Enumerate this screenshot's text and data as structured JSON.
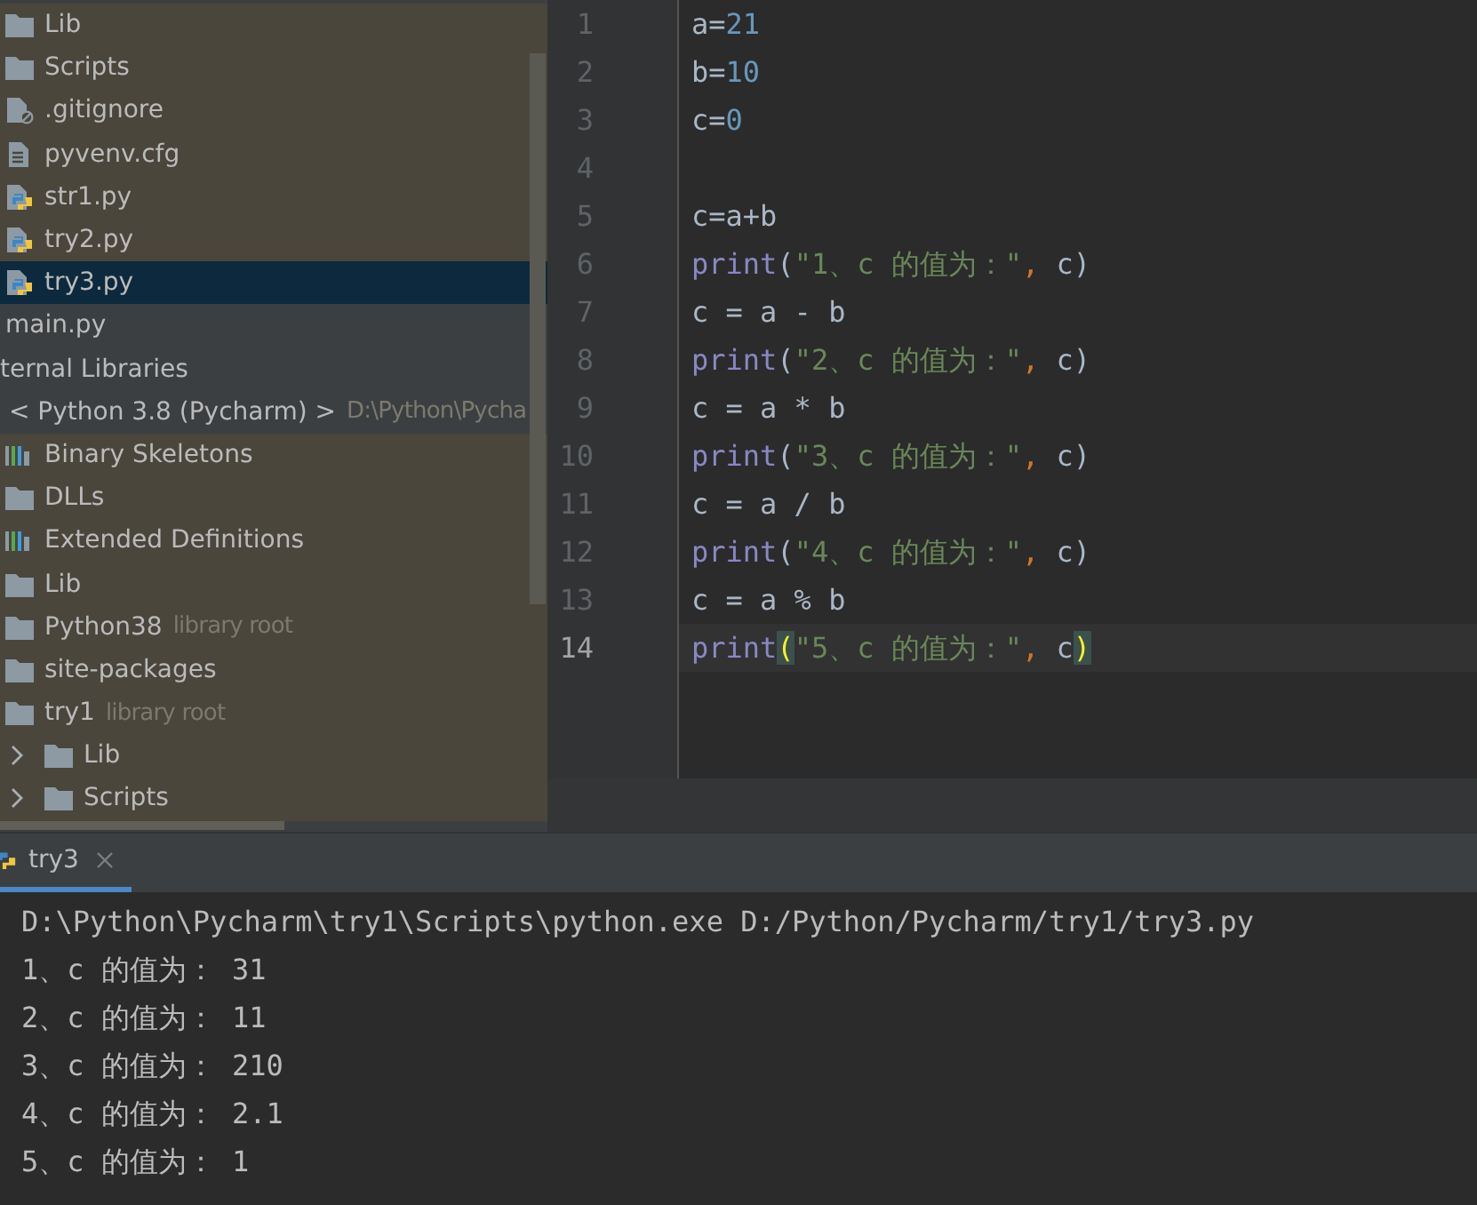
{
  "sidebar": {
    "files": [
      {
        "label": "Lib",
        "kind": "folder",
        "selected": false,
        "non_project": true
      },
      {
        "label": "Scripts",
        "kind": "folder",
        "selected": false,
        "non_project": true
      },
      {
        "label": ".gitignore",
        "kind": "ignored",
        "selected": false,
        "non_project": true
      },
      {
        "label": "pyvenv.cfg",
        "kind": "text",
        "selected": false,
        "non_project": true
      },
      {
        "label": "str1.py",
        "kind": "python",
        "selected": false,
        "non_project": true
      },
      {
        "label": "try2.py",
        "kind": "python",
        "selected": false,
        "non_project": true
      },
      {
        "label": "try3.py",
        "kind": "python",
        "selected": true,
        "non_project": true
      }
    ],
    "main_file": {
      "label": "main.py",
      "selected": false,
      "non_project": false
    },
    "libraries": {
      "label": "ternal Libraries",
      "non_project": false,
      "children": [
        {
          "label": "< Python 3.8 (Pycharm) >",
          "hint": "D:\\Python\\Pycha",
          "non_project": false,
          "children": [
            {
              "label": "Binary Skeletons",
              "kind": "library",
              "non_project": true
            },
            {
              "label": "DLLs",
              "kind": "folder",
              "non_project": true
            },
            {
              "label": "Extended Definitions",
              "kind": "library",
              "non_project": true
            },
            {
              "label": "Lib",
              "kind": "folder",
              "non_project": true
            },
            {
              "label": "Python38",
              "kind": "folder",
              "hint": "library root",
              "non_project": true
            },
            {
              "label": "site-packages",
              "kind": "folder",
              "non_project": true
            },
            {
              "label": "try1",
              "kind": "folder",
              "hint": "library root",
              "non_project": true,
              "children": [
                {
                  "label": "Lib",
                  "kind": "folder",
                  "expanded": false,
                  "non_project": true
                },
                {
                  "label": "Scripts",
                  "kind": "folder",
                  "expanded": false,
                  "non_project": true
                }
              ]
            }
          ]
        }
      ]
    }
  },
  "editor": {
    "lines": [
      {
        "number": "1",
        "current": false,
        "tokens": [
          {
            "text": "a=",
            "kind": "plain"
          },
          {
            "text": "21",
            "kind": "number"
          }
        ]
      },
      {
        "number": "2",
        "current": false,
        "tokens": [
          {
            "text": "b=",
            "kind": "plain"
          },
          {
            "text": "10",
            "kind": "number"
          }
        ]
      },
      {
        "number": "3",
        "current": false,
        "tokens": [
          {
            "text": "c=",
            "kind": "plain"
          },
          {
            "text": "0",
            "kind": "number"
          }
        ]
      },
      {
        "number": "4",
        "current": false
      },
      {
        "number": "5",
        "current": false,
        "tokens": [
          {
            "text": "c=a+b",
            "kind": "plain"
          }
        ]
      },
      {
        "number": "6",
        "current": false,
        "tokens": [
          {
            "text": "print",
            "kind": "builtin"
          },
          {
            "text": "(",
            "kind": "plain"
          },
          {
            "text": "\"1、c 的值为：\"",
            "kind": "string"
          },
          {
            "text": ",",
            "kind": "comma"
          },
          {
            "text": " c)",
            "kind": "plain"
          }
        ]
      },
      {
        "number": "7",
        "current": false,
        "tokens": [
          {
            "text": "c = a - b",
            "kind": "plain"
          }
        ]
      },
      {
        "number": "8",
        "current": false,
        "tokens": [
          {
            "text": "print",
            "kind": "builtin"
          },
          {
            "text": "(",
            "kind": "plain"
          },
          {
            "text": "\"2、c 的值为：\"",
            "kind": "string"
          },
          {
            "text": ",",
            "kind": "comma"
          },
          {
            "text": " c)",
            "kind": "plain"
          }
        ]
      },
      {
        "number": "9",
        "current": false,
        "tokens": [
          {
            "text": "c = a * b",
            "kind": "plain"
          }
        ]
      },
      {
        "number": "10",
        "current": false,
        "tokens": [
          {
            "text": "print",
            "kind": "builtin"
          },
          {
            "text": "(",
            "kind": "plain"
          },
          {
            "text": "\"3、c 的值为：\"",
            "kind": "string"
          },
          {
            "text": ",",
            "kind": "comma"
          },
          {
            "text": " c)",
            "kind": "plain"
          }
        ]
      },
      {
        "number": "11",
        "current": false,
        "tokens": [
          {
            "text": "c = a / b",
            "kind": "plain"
          }
        ]
      },
      {
        "number": "12",
        "current": false,
        "tokens": [
          {
            "text": "print",
            "kind": "builtin"
          },
          {
            "text": "(",
            "kind": "plain"
          },
          {
            "text": "\"4、c 的值为：\"",
            "kind": "string"
          },
          {
            "text": ",",
            "kind": "comma"
          },
          {
            "text": " c)",
            "kind": "plain"
          }
        ]
      },
      {
        "number": "13",
        "current": false,
        "tokens": [
          {
            "text": "c = a % b",
            "kind": "plain"
          }
        ]
      },
      {
        "number": "14",
        "current": true,
        "tokens": [
          {
            "text": "print",
            "kind": "builtin"
          },
          {
            "text": "(",
            "kind": "brace-match"
          },
          {
            "text": "\"5、c 的值为：\"",
            "kind": "string"
          },
          {
            "text": ",",
            "kind": "comma"
          },
          {
            "text": " c",
            "kind": "plain"
          },
          {
            "text": ")",
            "kind": "brace-match"
          }
        ]
      }
    ]
  },
  "run_panel": {
    "tab": {
      "label": "try3",
      "selected": true
    },
    "output": [
      "D:\\Python\\Pycharm\\try1\\Scripts\\python.exe D:/Python/Pycharm/try1/try3.py",
      "1、c 的值为： 31",
      "2、c 的值为： 11",
      "3、c 的值为： 210",
      "4、c 的值为： 2.1",
      "5、c 的值为： 1"
    ]
  }
}
